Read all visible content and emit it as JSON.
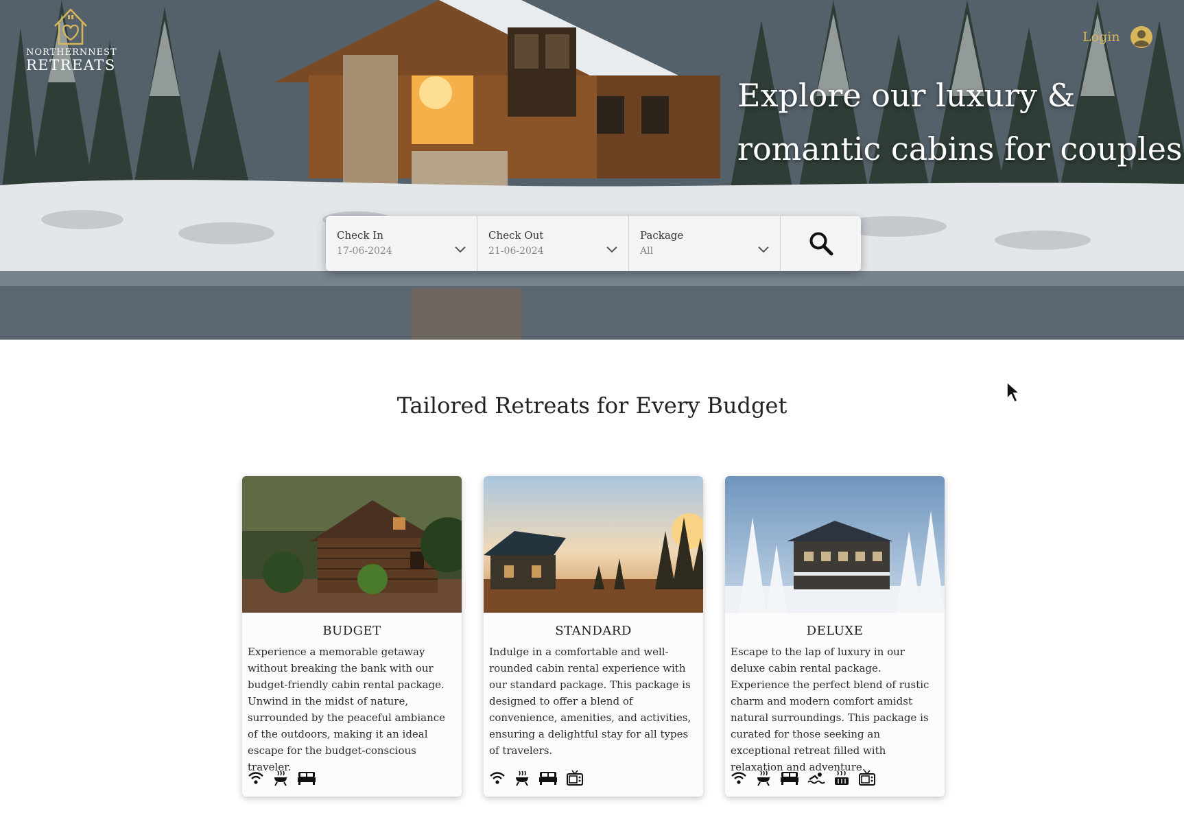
{
  "brand": {
    "name_top": "NORTHERNNEST",
    "name_bottom": "RETREATS",
    "logo_icon": "house-heart-icon",
    "accent_color": "#d8b75a"
  },
  "header": {
    "login_label": "Login",
    "user_icon": "user-circle-icon"
  },
  "hero": {
    "headline_line1": "Explore our luxury &",
    "headline_line2": "romantic cabins for couples"
  },
  "search": {
    "check_in": {
      "label": "Check In",
      "value": "17-06-2024"
    },
    "check_out": {
      "label": "Check Out",
      "value": "21-06-2024"
    },
    "package": {
      "label": "Package",
      "value": "All"
    },
    "search_icon": "search-icon"
  },
  "section": {
    "title": "Tailored Retreats for Every Budget"
  },
  "packages": [
    {
      "title": "BUDGET",
      "description": "Experience a memorable getaway without breaking the bank with our budget-friendly cabin rental package. Unwind in the midst of nature, surrounded by the peaceful ambiance of the outdoors, making it an ideal escape for the budget-conscious traveler.",
      "amenities": [
        "wifi-icon",
        "bbq-grill-icon",
        "bed-icon"
      ]
    },
    {
      "title": "STANDARD",
      "description": "Indulge in a comfortable and well-rounded cabin rental experience with our standard package. This package is designed to offer a blend of convenience, amenities, and activities, ensuring a delightful stay for all types of travelers.",
      "amenities": [
        "wifi-icon",
        "bbq-grill-icon",
        "bed-icon",
        "tv-icon"
      ]
    },
    {
      "title": "DELUXE",
      "description": "Escape to the lap of luxury in our deluxe cabin rental package. Experience the perfect blend of rustic charm and modern comfort amidst natural surroundings. This package is curated for those seeking an exceptional retreat filled with relaxation and adventure.",
      "amenities": [
        "wifi-icon",
        "bbq-grill-icon",
        "bed-icon",
        "swimming-icon",
        "hot-tub-icon",
        "tv-icon"
      ]
    }
  ]
}
